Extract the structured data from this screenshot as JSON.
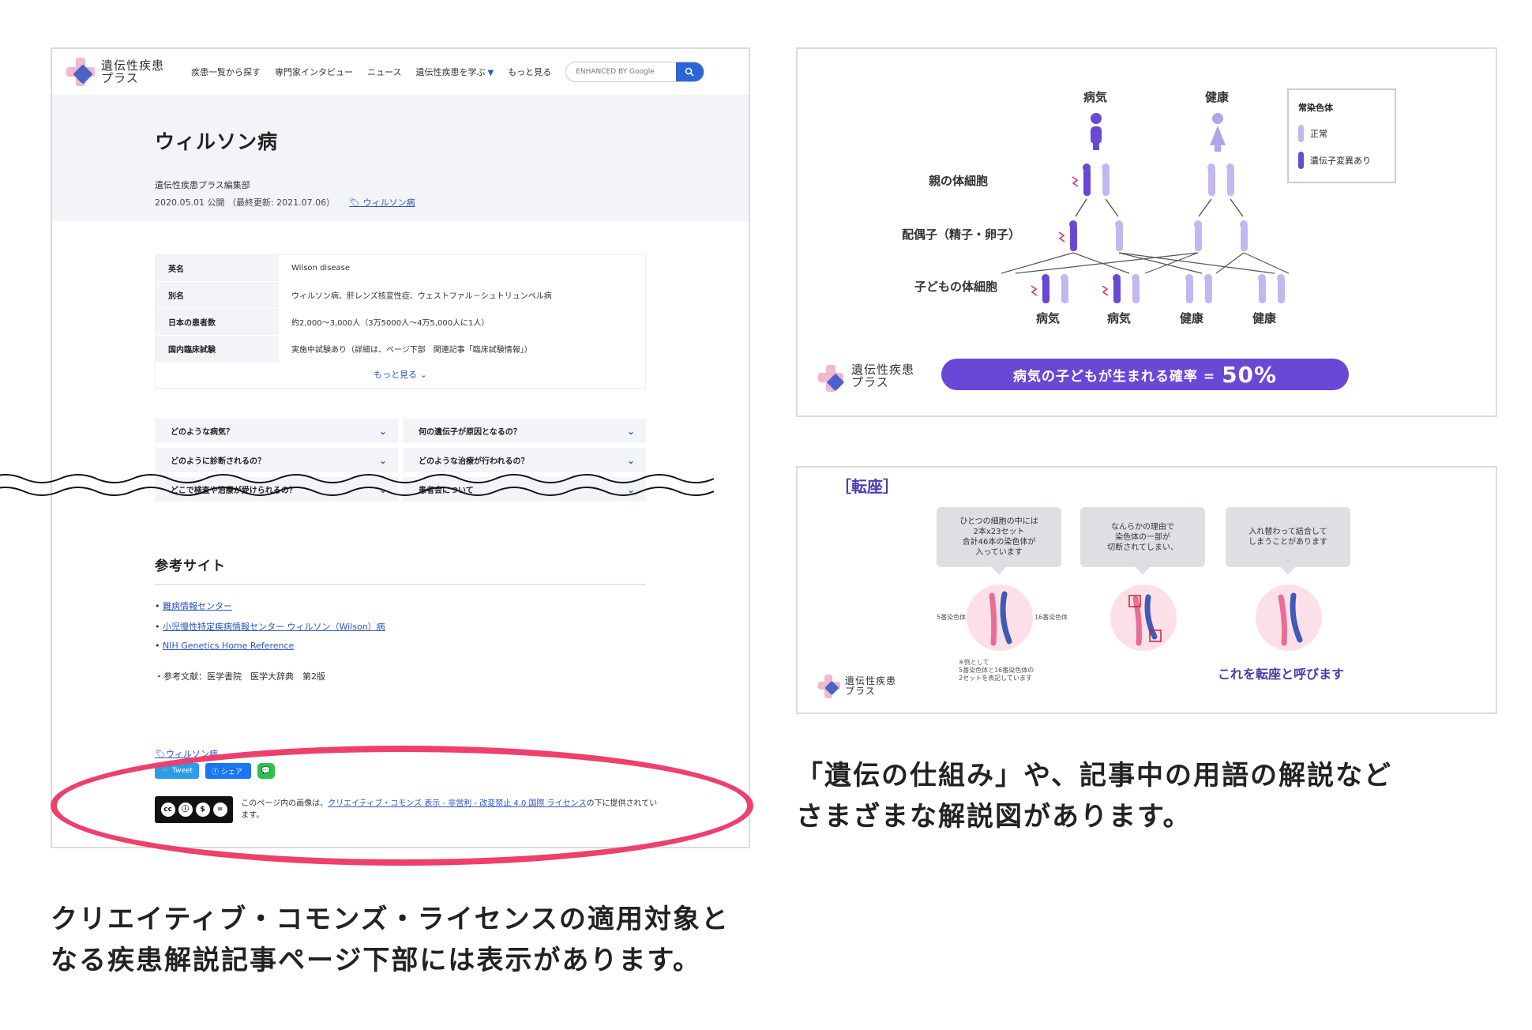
{
  "site": {
    "logo_line1": "遺伝性疾患",
    "logo_line2": "プラス",
    "nav": [
      "疾患一覧から探す",
      "専門家インタビュー",
      "ニュース",
      "遺伝性疾患を学ぶ",
      "もっと見る"
    ],
    "search_placeholder": "ENHANCED BY Google"
  },
  "article": {
    "title": "ウィルソン病",
    "author": "遺伝性疾患プラス編集部",
    "dates": "2020.05.01 公開 （最終更新: 2021.07.06）",
    "tag": "ウィルソン病",
    "info_rows": [
      {
        "key": "英名",
        "value": "Wilson disease"
      },
      {
        "key": "別名",
        "value": "ウィルソン病、肝レンズ核変性症、ウェストファル－シュトリュンペル病"
      },
      {
        "key": "日本の患者数",
        "value": "約2,000～3,000人（3万5000人～4万5,000人に1人）"
      },
      {
        "key": "国内臨床試験",
        "value": "実施中試験あり（詳細は、ページ下部　関連記事「臨床試験情報」）"
      }
    ],
    "more_label": "もっと見る",
    "faq": [
      "どのような病気？",
      "何の遺伝子が原因となるの？",
      "どのように診断されるの？",
      "どのような治療が行われるの？",
      "どこで検査や治療が受けられるの？",
      "患者会について"
    ],
    "refs_heading": "参考サイト",
    "refs": [
      "難病情報センター",
      "小児慢性特定疾病情報センター ウィルソン（Wilson）病",
      "NIH Genetics Home Reference"
    ],
    "literature": "・参考文献：医学書院　医学大辞典　第2版",
    "share": {
      "tweet": "Tweet",
      "facebook": "シェア"
    },
    "cc_prefix": "このページ内の画像は、",
    "cc_link": "クリエイティブ・コモンズ 表示 - 非営利 - 改変禁止 4.0 国際 ライセンス",
    "cc_suffix": "の下に提供されています。",
    "cc_badge": "BY NC ND"
  },
  "captions": {
    "left_line1": "クリエイティブ・コモンズ・ライセンスの適用対象と",
    "left_line2": "なる疾患解説記事ページ下部には表示があります。",
    "right_line1": "「遺伝の仕組み」や、記事中の用語の解説など",
    "right_line2": "さまざまな解説図があります。"
  },
  "diagram": {
    "top_labels": [
      "病気",
      "健康"
    ],
    "row_labels": [
      "親の体細胞",
      "配偶子（精子・卵子）",
      "子どもの体細胞"
    ],
    "bottom_labels": [
      "病気",
      "病気",
      "健康",
      "健康"
    ],
    "legend_title": "常染色体",
    "legend_normal": "正常",
    "legend_mutant": "遺伝子変異あり",
    "probability_text": "病気の子どもが生まれる確率 =",
    "probability_value": "50%"
  },
  "translocation": {
    "title": "［転座］",
    "bubbles": [
      "ひとつの細胞の中には\n2本x23セット\n合計46本の染色体が\n入っています",
      "なんらかの理由で\n染色体の一部が\n切断されてしまい、",
      "入れ替わって結合して\nしまうことがあります"
    ],
    "chrom_left": "5番染色体",
    "chrom_right": "16番染色体",
    "note": "※例として\n5番染色体と16番染色体の\n2セットを表記しています",
    "conclusion": "これを転座と呼びます"
  },
  "colors": {
    "accent": "#6a48d6",
    "link": "#2a56c6",
    "highlight": "#ef3f6b",
    "pink": "#f3b7cf"
  }
}
